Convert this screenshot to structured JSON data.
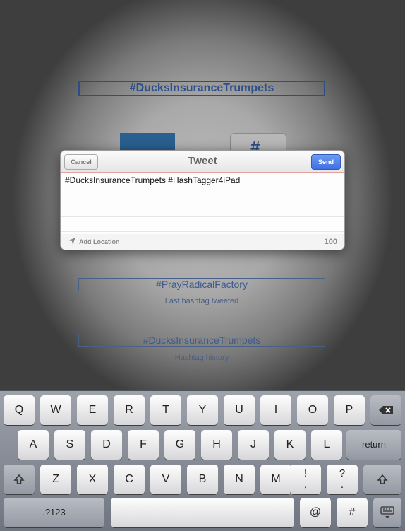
{
  "background": {
    "top_hashtag": "#DucksInsuranceTrumpets",
    "tile_hash_glyph": "#",
    "last_hashtag": "#PrayRadicalFactory",
    "last_hashtag_label": "Last hashtag tweeted",
    "history_hashtag": "#DucksInsuranceTrumpets",
    "history_label": "Hashtag history"
  },
  "tweet_sheet": {
    "title": "Tweet",
    "cancel_label": "Cancel",
    "send_label": "Send",
    "text": "#DucksInsuranceTrumpets #HashTagger4iPad",
    "add_location_label": "Add Location",
    "char_count": "100",
    "colors": {
      "send": "#4a7be8",
      "header_rule": "#e3a2a2"
    }
  },
  "keyboard": {
    "row1": [
      "Q",
      "W",
      "E",
      "R",
      "T",
      "Y",
      "U",
      "I",
      "O",
      "P"
    ],
    "row2": [
      "A",
      "S",
      "D",
      "F",
      "G",
      "H",
      "J",
      "K",
      "L"
    ],
    "row3": [
      "Z",
      "X",
      "C",
      "V",
      "B",
      "N",
      "M"
    ],
    "return_label": "return",
    "numbers_label": ".?123",
    "exclaim_top": "!",
    "exclaim_bottom": ",",
    "question_top": "?",
    "question_bottom": ".",
    "at_label": "@",
    "hash_label": "#",
    "icons": [
      "backspace-icon",
      "shift-icon",
      "keyboard-dismiss-icon"
    ]
  }
}
